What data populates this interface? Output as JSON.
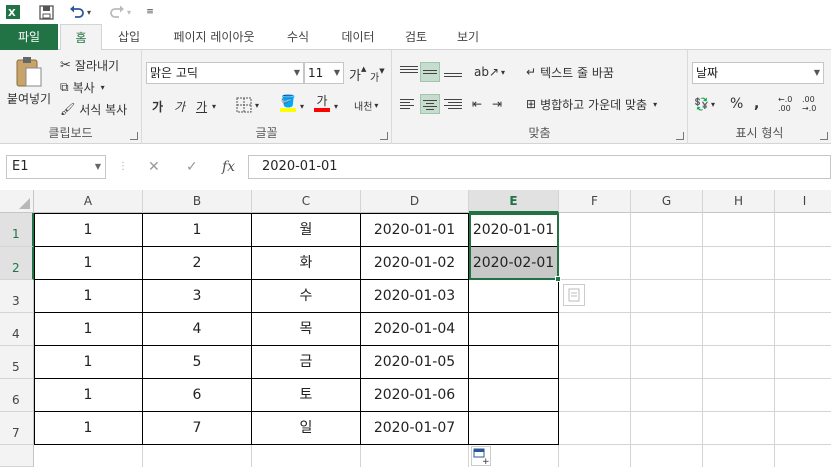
{
  "qat": {
    "icons": [
      "excel-logo",
      "save",
      "undo",
      "redo",
      "customize"
    ]
  },
  "tabs": [
    "파일",
    "홈",
    "삽입",
    "페이지 레이아웃",
    "수식",
    "데이터",
    "검토",
    "보기"
  ],
  "ribbon": {
    "clipboard": {
      "label": "클립보드",
      "paste": "붙여넣기",
      "cut": "잘라내기",
      "copy": "복사",
      "format_painter": "서식 복사"
    },
    "font": {
      "label": "글꼴",
      "font_name": "맑은 고딕",
      "font_size": "11",
      "grow": "가",
      "shrink": "가",
      "bold": "가",
      "italic": "가",
      "underline": "가",
      "font_color_glyph": "가",
      "phonetic": "내천"
    },
    "alignment": {
      "label": "맞춤",
      "wrap_text": "텍스트 줄 바꿈",
      "merge_center": "병합하고 가운데 맞춤"
    },
    "number": {
      "label": "표시 형식",
      "format": "날짜",
      "percent": "%",
      "comma": ",",
      "inc_decimal": "←.0\n.00",
      "dec_decimal": ".00\n→.0"
    },
    "colors": {
      "fill": "#ffff00",
      "font": "#ff0000",
      "accent": "#217346"
    }
  },
  "formula_bar": {
    "name_box": "E1",
    "cancel": "✕",
    "enter": "✓",
    "fx": "fx",
    "value": "2020-01-01"
  },
  "grid": {
    "columns": [
      "A",
      "B",
      "C",
      "D",
      "E",
      "F",
      "G",
      "H",
      "I"
    ],
    "rows": [
      "1",
      "2",
      "3",
      "4",
      "5",
      "6",
      "7"
    ],
    "data": [
      [
        "1",
        "1",
        "월",
        "2020-01-01",
        "2020-01-01"
      ],
      [
        "1",
        "2",
        "화",
        "2020-01-02",
        "2020-02-01"
      ],
      [
        "1",
        "3",
        "수",
        "2020-01-03",
        ""
      ],
      [
        "1",
        "4",
        "목",
        "2020-01-04",
        ""
      ],
      [
        "1",
        "5",
        "금",
        "2020-01-05",
        ""
      ],
      [
        "1",
        "6",
        "토",
        "2020-01-06",
        ""
      ],
      [
        "1",
        "7",
        "일",
        "2020-01-07",
        ""
      ]
    ],
    "selected_column": "E",
    "selected_rows": [
      "1",
      "2"
    ]
  }
}
